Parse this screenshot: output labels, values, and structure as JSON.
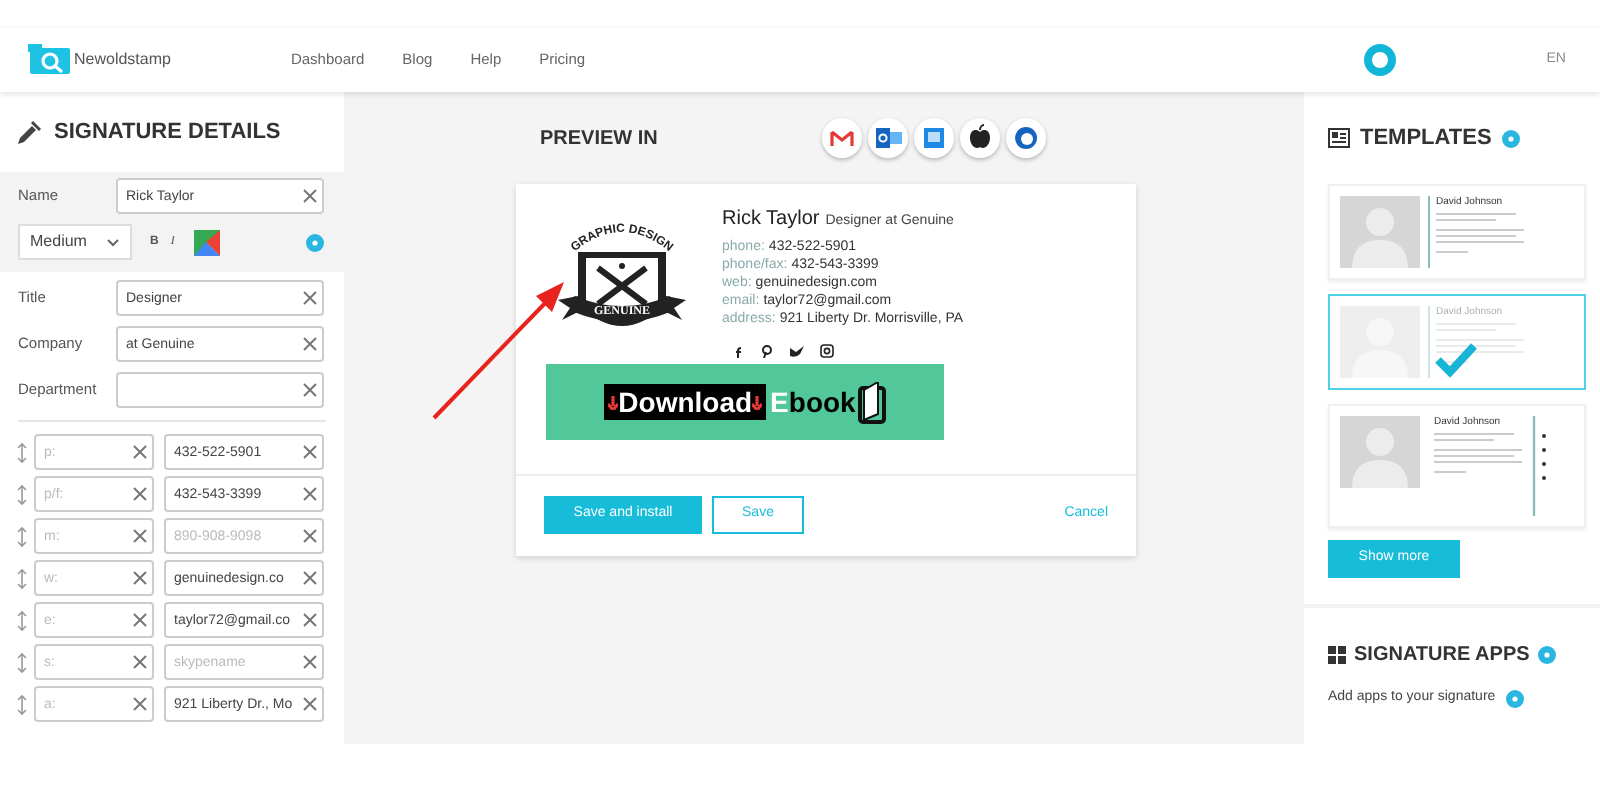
{
  "nav": {
    "logo": "Newoldstamp",
    "links": [
      "Dashboard",
      "Blog",
      "Help",
      "Pricing"
    ],
    "language": "EN"
  },
  "details": {
    "title": "SIGNATURE DETAILS",
    "name": {
      "label": "Name",
      "value": "Rick Taylor"
    },
    "font_size": "Medium",
    "bold": "B",
    "italic": "I",
    "fields": [
      {
        "label": "Title",
        "value": "Designer"
      },
      {
        "label": "Company",
        "value": "at Genuine"
      },
      {
        "label": "Department"
      }
    ],
    "contacts": [
      {
        "label_placeholder": "p:",
        "value": "432-522-5901"
      },
      {
        "label_placeholder": "p/f:",
        "value": "432-543-3399"
      },
      {
        "label_placeholder": "m:",
        "placeholder": "890-908-9098"
      },
      {
        "label_placeholder": "w:",
        "value": "genuinedesign.co"
      },
      {
        "label_placeholder": "e:",
        "value": "taylor72@gmail.co"
      },
      {
        "label_placeholder": "s:",
        "placeholder": "skypename"
      },
      {
        "label_placeholder": "a:",
        "value": "921 Liberty Dr., Mo"
      }
    ]
  },
  "preview": {
    "title": "PREVIEW IN",
    "logo": {
      "arc_text": "GRAPHIC DESIGN",
      "ribbon_text": "GENUINE"
    },
    "name": "Rick Taylor",
    "position": "Designer at Genuine",
    "lines": [
      {
        "label": "phone:",
        "value": "432-522-5901"
      },
      {
        "label": "phone/fax:",
        "value": "432-543-3399"
      },
      {
        "label": "web:",
        "value": "genuinedesign.com"
      },
      {
        "label": "email:",
        "value": "taylor72@gmail.com"
      },
      {
        "label": "address:",
        "value": "921 Liberty Dr. Morrisville, PA"
      }
    ],
    "banner": {
      "download": "Download",
      "ebook": "Ebook"
    },
    "buttons": {
      "save_install": "Save and install",
      "save": "Save",
      "cancel": "Cancel"
    }
  },
  "templates": {
    "title": "TEMPLATES",
    "items": [
      {
        "name": "David Johnson",
        "selected": false,
        "kind": "left"
      },
      {
        "name": "David Johnson",
        "selected": true,
        "kind": "left"
      },
      {
        "name": "David Johnson",
        "selected": false,
        "kind": "social"
      }
    ],
    "show_more": "Show more"
  },
  "apps": {
    "title": "SIGNATURE APPS",
    "subtitle": "Add apps to your signature"
  }
}
